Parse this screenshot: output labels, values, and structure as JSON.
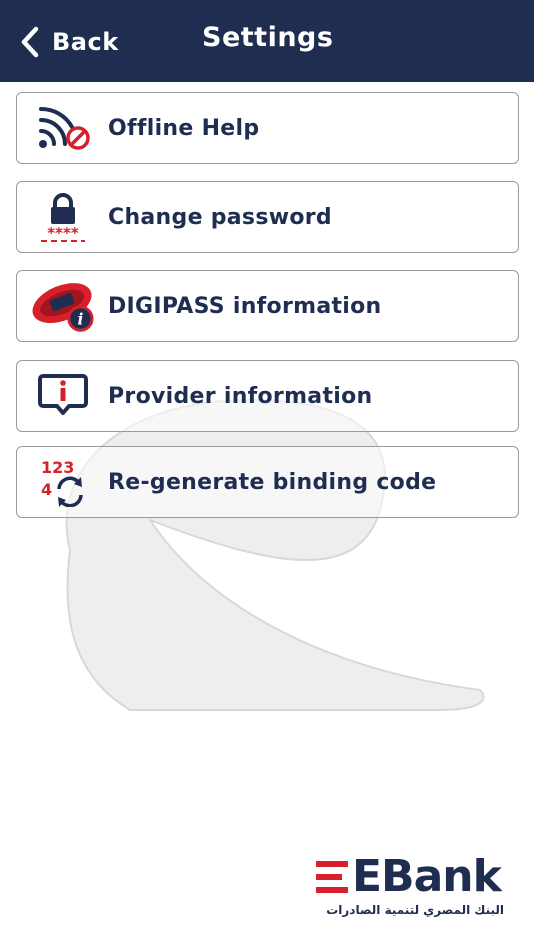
{
  "header": {
    "back_label": "Back",
    "title": "Settings"
  },
  "colors": {
    "navy": "#1e2d50",
    "red": "#d6202c"
  },
  "menu": {
    "items": [
      {
        "label": "Offline Help",
        "icon": "wifi-off-icon"
      },
      {
        "label": "Change password",
        "icon": "password-lock-icon"
      },
      {
        "label": "DIGIPASS information",
        "icon": "digipass-token-icon"
      },
      {
        "label": "Provider information",
        "icon": "info-message-icon"
      },
      {
        "label": "Re-generate binding code",
        "icon": "regenerate-code-icon"
      }
    ]
  },
  "branding": {
    "logo_text": "EBank",
    "arabic_name": "البنك المصري لتنمية الصادرات"
  }
}
